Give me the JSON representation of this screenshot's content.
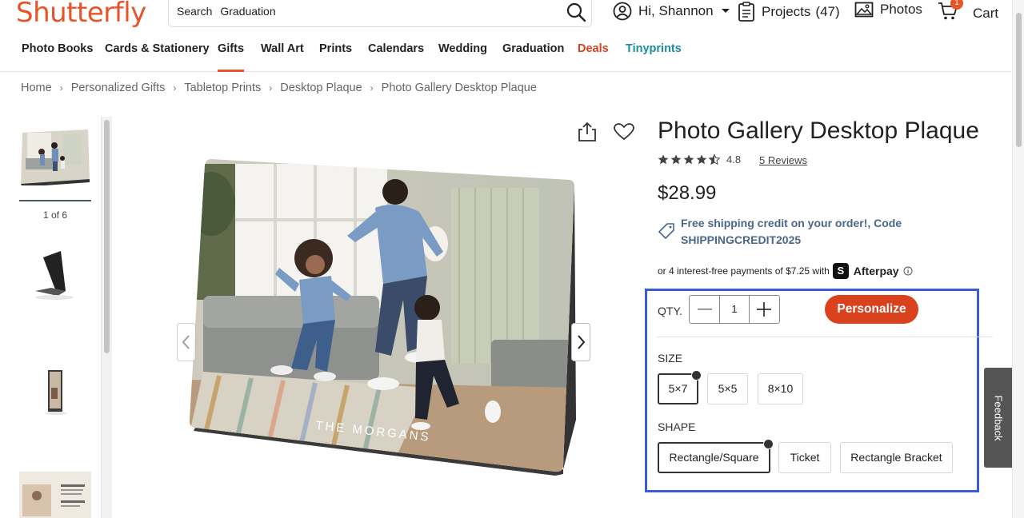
{
  "header": {
    "logo": "Shutterfly",
    "search_label": "Search",
    "search_value": "Graduation",
    "user_greeting": "Hi, Shannon",
    "projects_label": "Projects",
    "projects_count": "(47)",
    "photos_label": "Photos",
    "cart_label": "Cart",
    "cart_count": "1"
  },
  "nav": {
    "items": [
      "Photo Books",
      "Cards & Stationery",
      "Gifts",
      "Wall Art",
      "Prints",
      "Calendars",
      "Wedding",
      "Graduation",
      "Deals",
      "Tinyprints"
    ],
    "active": "Gifts"
  },
  "breadcrumb": [
    "Home",
    "Personalized Gifts",
    "Tabletop Prints",
    "Desktop Plaque",
    "Photo Gallery Desktop Plaque"
  ],
  "gallery": {
    "counter": "1 of 6",
    "overlay_text": "THE MORGANS"
  },
  "product": {
    "title": "Photo Gallery Desktop Plaque",
    "rating": "4.8",
    "reviews": "5 Reviews",
    "price": "$28.99",
    "promo_line1": "Free shipping credit on your order!, Code",
    "promo_line2": "SHIPPINGCREDIT2025",
    "afterpay_text": "or 4 interest-free payments of $7.25 with",
    "afterpay_brand": "Afterpay"
  },
  "options": {
    "qty_label": "QTY.",
    "qty_value": "1",
    "personalize_label": "Personalize",
    "size_label": "SIZE",
    "sizes": [
      "5×7",
      "5×5",
      "8×10"
    ],
    "selected_size": "5×7",
    "shape_label": "SHAPE",
    "shapes": [
      "Rectangle/Square",
      "Ticket",
      "Rectangle Bracket"
    ],
    "selected_shape": "Rectangle/Square"
  },
  "feedback_label": "Feedback",
  "colors": {
    "brand": "#e8542a",
    "cta": "#d9421d",
    "promo": "#4a6688",
    "link_teal": "#1b8ba6",
    "highlight_box": "#3b5bdb"
  }
}
